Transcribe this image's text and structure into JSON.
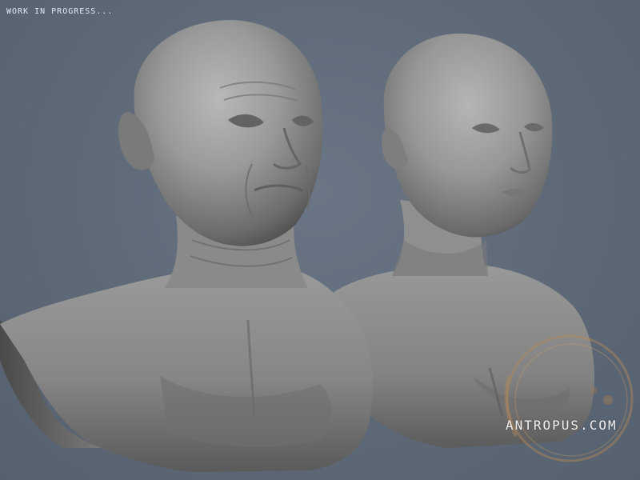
{
  "caption": {
    "text": "WORK IN PROGRESS..."
  },
  "watermark": {
    "text": "ANTROPUS.COM"
  },
  "colors": {
    "background": "#5d6977",
    "clay_light": "#a9a9a9",
    "clay_mid": "#8d8d8d",
    "clay_dark": "#5e5e5e",
    "stain": "#b5895a"
  }
}
